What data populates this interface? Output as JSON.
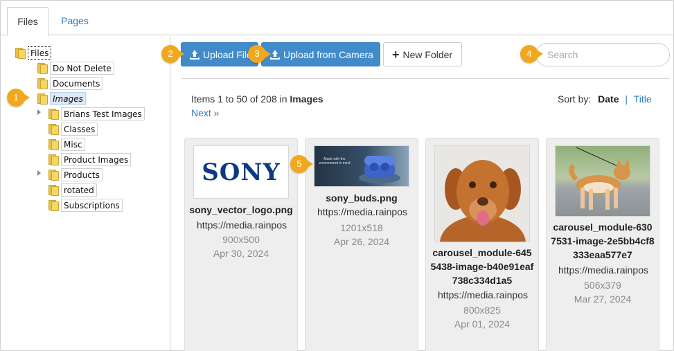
{
  "tabs": [
    {
      "label": "Files",
      "active": true
    },
    {
      "label": "Pages",
      "active": false
    }
  ],
  "tree": {
    "root": "Files",
    "items": [
      {
        "label": "Do Not Delete"
      },
      {
        "label": "Documents"
      },
      {
        "label": "Images",
        "selected": true
      },
      {
        "label": "Brians Test Images",
        "expandable": true
      },
      {
        "label": "Classes"
      },
      {
        "label": "Misc"
      },
      {
        "label": "Product Images"
      },
      {
        "label": "Products",
        "expandable": true
      },
      {
        "label": "rotated"
      },
      {
        "label": "Subscriptions"
      }
    ]
  },
  "toolbar": {
    "upload_file": "Upload File",
    "upload_camera": "Upload from Camera",
    "new_folder": "New Folder",
    "search_placeholder": "Search"
  },
  "status": {
    "range": "Items 1 to 50 of 208 in",
    "folder": "Images",
    "next": "Next »"
  },
  "sort": {
    "label": "Sort by:",
    "date": "Date",
    "separator": "|",
    "title": "Title"
  },
  "cards": [
    {
      "name": "sony_vector_logo.png",
      "url": "https://media.rainpos",
      "size": "900x500",
      "date": "Apr 30, 2024",
      "thumb_text": "SONY"
    },
    {
      "name": "sony_buds.png",
      "url": "https://media.rainpos",
      "size": "1201x518",
      "date": "Apr 26, 2024",
      "thumb_text": "Made with the environment in mind"
    },
    {
      "name": "carousel_module-6455438-image-b40e91eaf738c334d1a5",
      "url": "https://media.rainpos",
      "size": "800x825",
      "date": "Apr 01, 2024"
    },
    {
      "name": "carousel_module-6307531-image-2e5bb4cf8333eaa577e7",
      "url": "https://media.rainpos",
      "size": "506x379",
      "date": "Mar 27, 2024"
    }
  ],
  "callouts": [
    "1",
    "2",
    "3",
    "4",
    "5"
  ],
  "colors": {
    "primary": "#428bca",
    "link": "#337ab7",
    "callout": "#f2a81d",
    "folder": "#f4d766",
    "card_bg": "#eeeeee"
  }
}
